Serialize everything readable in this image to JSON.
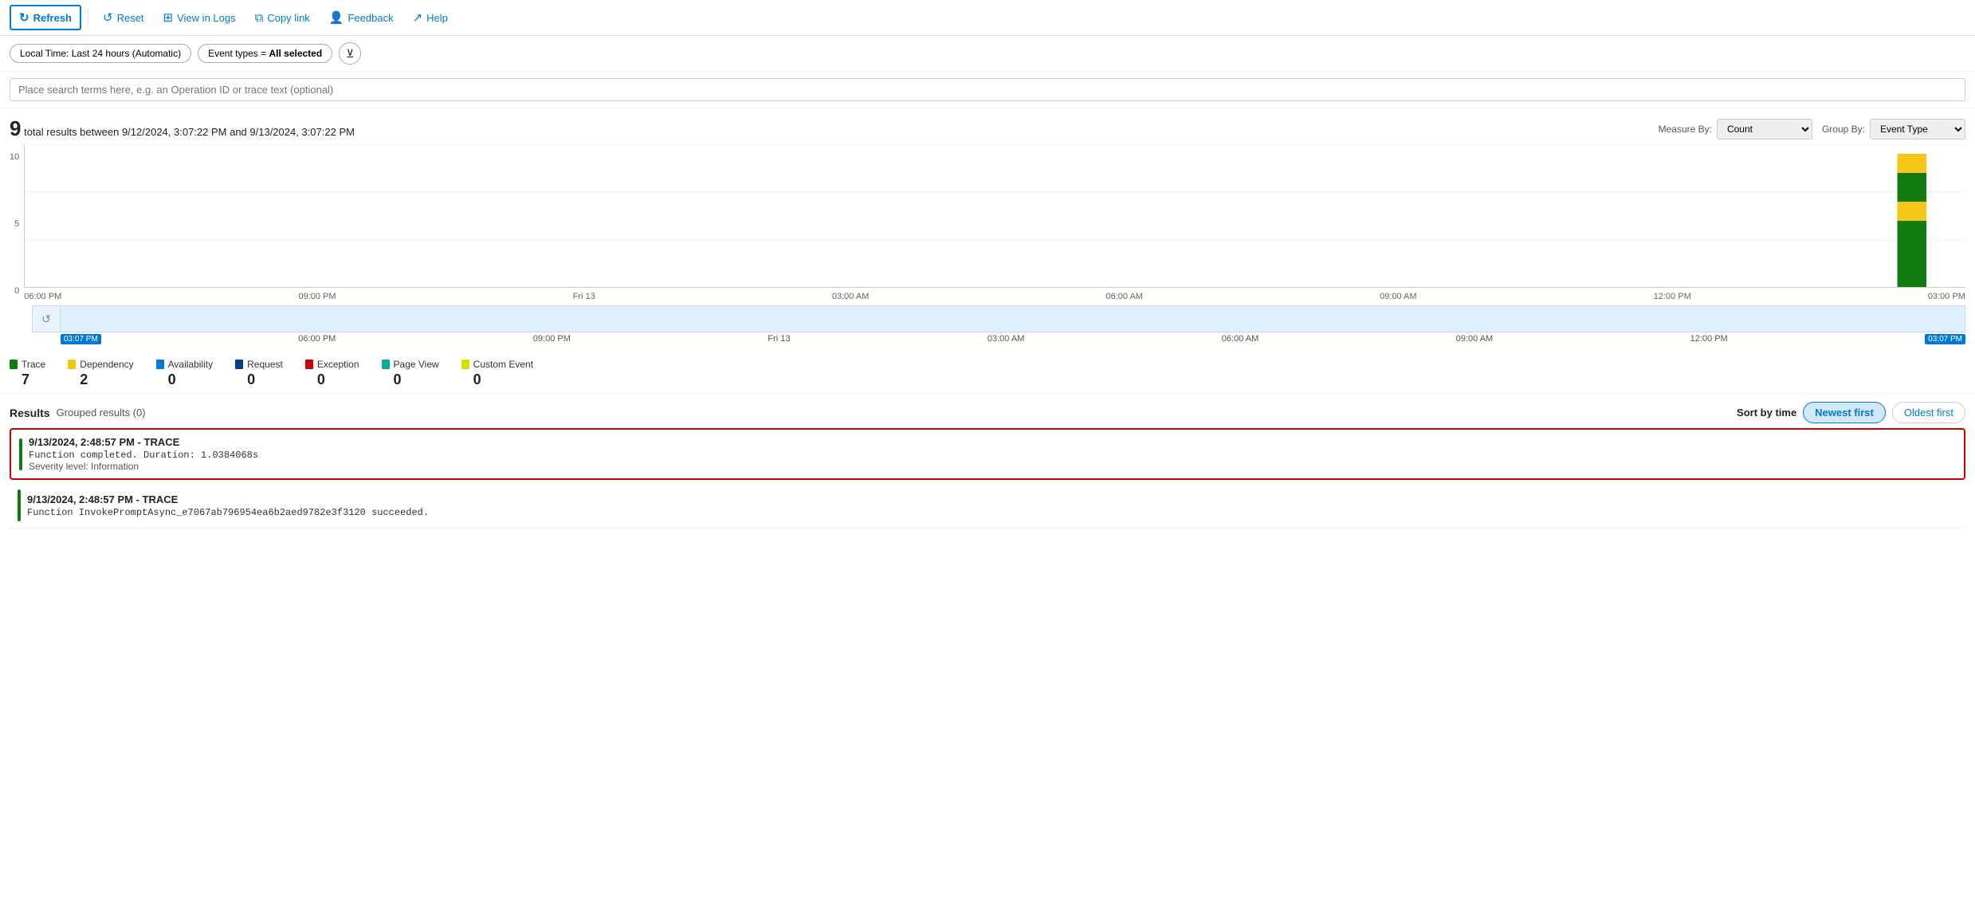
{
  "toolbar": {
    "refresh_label": "Refresh",
    "reset_label": "Reset",
    "view_in_logs_label": "View in Logs",
    "copy_link_label": "Copy link",
    "feedback_label": "Feedback",
    "help_label": "Help"
  },
  "filters": {
    "time_range_label": "Local Time: Last 24 hours (Automatic)",
    "event_types_label": "Event types = ",
    "event_types_value": "All selected"
  },
  "search": {
    "placeholder": "Place search terms here, e.g. an Operation ID or trace text (optional)"
  },
  "summary": {
    "count": "9",
    "description": "total results between 9/12/2024, 3:07:22 PM and 9/13/2024, 3:07:22 PM",
    "measure_by_label": "Measure By:",
    "measure_by_value": "Count",
    "group_by_label": "Group By:",
    "group_by_value": "Event Type"
  },
  "chart": {
    "y_labels": [
      "10",
      "5",
      "0"
    ],
    "x_labels": [
      "06:00 PM",
      "09:00 PM",
      "Fri 13",
      "03:00 AM",
      "06:00 AM",
      "09:00 AM",
      "12:00 PM",
      "03:00 PM"
    ],
    "timeline_x_labels": [
      "06:00 PM",
      "09:00 PM",
      "Fri 13",
      "03:00 AM",
      "06:00 AM",
      "09:00 AM",
      "12:00 PM",
      "03:00 PM"
    ],
    "start_time": "03:07 PM",
    "end_time": "03:07 PM"
  },
  "legend": [
    {
      "label": "Trace",
      "color": "#107c10",
      "count": "7"
    },
    {
      "label": "Dependency",
      "color": "#f5c518",
      "count": "2"
    },
    {
      "label": "Availability",
      "color": "#0078d4",
      "count": "0"
    },
    {
      "label": "Request",
      "color": "#003f8a",
      "count": "0"
    },
    {
      "label": "Exception",
      "color": "#c00",
      "count": "0"
    },
    {
      "label": "Page View",
      "color": "#00b294",
      "count": "0"
    },
    {
      "label": "Custom Event",
      "color": "#d4e000",
      "count": "0"
    }
  ],
  "results": {
    "title": "Results",
    "grouped_label": "Grouped results (0)",
    "sort_label": "Sort by time",
    "newest_first": "Newest first",
    "oldest_first": "Oldest first"
  },
  "result_items": [
    {
      "id": "item1",
      "highlighted": true,
      "timestamp": "9/13/2024, 2:48:57 PM - TRACE",
      "body": "Function completed. Duration: 1.0384068s",
      "severity": "Severity level: Information"
    },
    {
      "id": "item2",
      "highlighted": false,
      "timestamp": "9/13/2024, 2:48:57 PM - TRACE",
      "body": "Function InvokePromptAsync_e7067ab796954ea6b2aed9782e3f3120 succeeded.",
      "severity": ""
    }
  ]
}
